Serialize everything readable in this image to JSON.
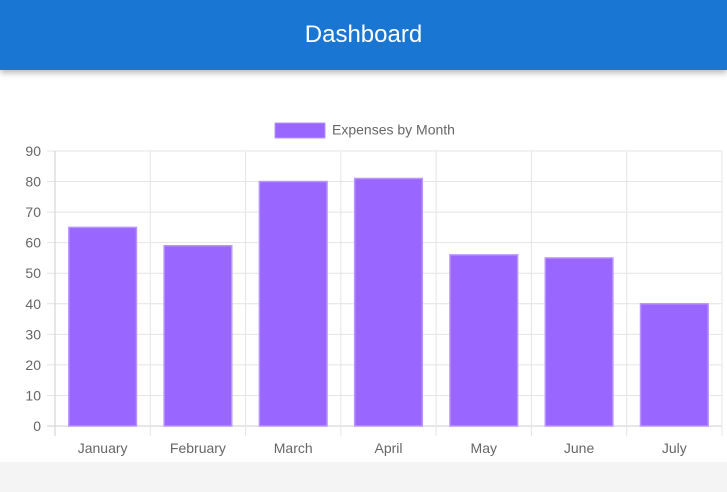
{
  "app_bar": {
    "title": "Dashboard",
    "color": "#1976d2"
  },
  "chart_data": {
    "type": "bar",
    "categories": [
      "January",
      "February",
      "March",
      "April",
      "May",
      "June",
      "July"
    ],
    "series": [
      {
        "name": "Expenses by Month",
        "values": [
          65,
          59,
          80,
          81,
          56,
          55,
          40
        ],
        "color": "#9966ff"
      }
    ],
    "ylim": [
      0,
      90
    ],
    "yticks": [
      0,
      10,
      20,
      30,
      40,
      50,
      60,
      70,
      80,
      90
    ],
    "grid": true,
    "legend": "top-center"
  }
}
